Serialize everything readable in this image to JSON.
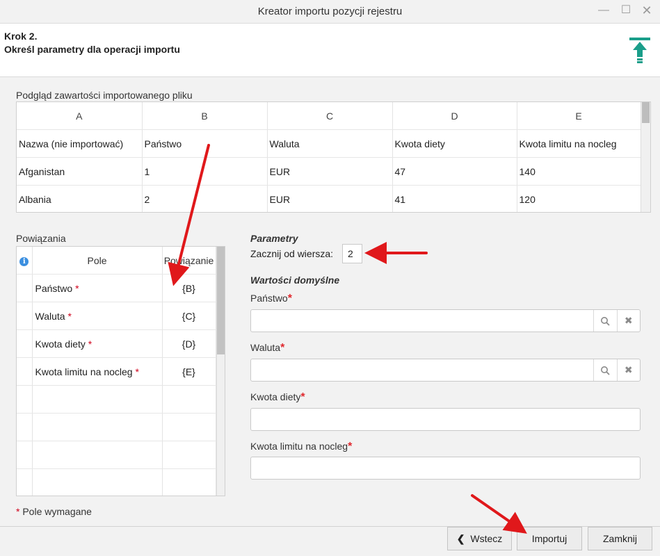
{
  "window": {
    "title": "Kreator importu pozycji rejestru",
    "minimize_icon": "minimize-icon",
    "maximize_icon": "maximize-icon",
    "close_icon": "close-icon"
  },
  "step": {
    "number": "Krok 2.",
    "description": "Określ parametry dla operacji importu",
    "icon": "import-upload-icon",
    "icon_color": "#1a9e8a"
  },
  "preview": {
    "label": "Podgląd zawartości importowanego pliku",
    "columns": [
      "A",
      "B",
      "C",
      "D",
      "E"
    ],
    "rows": [
      [
        "Nazwa (nie importować)",
        "Państwo",
        "Waluta",
        "Kwota diety",
        "Kwota limitu na nocleg"
      ],
      [
        "Afganistan",
        "1",
        "EUR",
        "47",
        "140"
      ],
      [
        "Albania",
        "2",
        "EUR",
        "41",
        "120"
      ]
    ]
  },
  "bindings": {
    "label": "Powiązania",
    "header_icon": "info-icon",
    "header_icon_glyph": "i",
    "columns": [
      "Pole",
      "Powiązanie"
    ],
    "rows": [
      {
        "field": "Państwo",
        "required": "*",
        "binding": "{B}"
      },
      {
        "field": "Waluta",
        "required": "*",
        "binding": "{C}"
      },
      {
        "field": "Kwota diety",
        "required": "*",
        "binding": "{D}"
      },
      {
        "field": "Kwota limitu na nocleg",
        "required": "*",
        "binding": "{E}"
      }
    ]
  },
  "parameters": {
    "title": "Parametry",
    "start_row_label": "Zacznij od wiersza:",
    "start_row_value": "2"
  },
  "defaults": {
    "title": "Wartości domyślne",
    "fields": [
      {
        "label": "Państwo",
        "star": "*",
        "value": "",
        "lookup": true
      },
      {
        "label": "Waluta",
        "star": "*",
        "value": "",
        "lookup": true
      },
      {
        "label": "Kwota diety",
        "star": "*",
        "value": "",
        "lookup": false
      },
      {
        "label": "Kwota limitu na nocleg",
        "star": "*",
        "value": "",
        "lookup": false
      }
    ],
    "search_icon": "search-icon",
    "clear_icon": "clear-x-icon"
  },
  "required_note": {
    "star": "*",
    "text": "Pole wymagane"
  },
  "footer": {
    "back_label": "Wstecz",
    "back_icon": "chevron-left-icon",
    "import_label": "Importuj",
    "close_label": "Zamknij"
  },
  "colors": {
    "accent": "#1a9e8a",
    "required": "#d0021b",
    "annotation_arrow": "#e0181b",
    "info": "#3b8fe0"
  }
}
